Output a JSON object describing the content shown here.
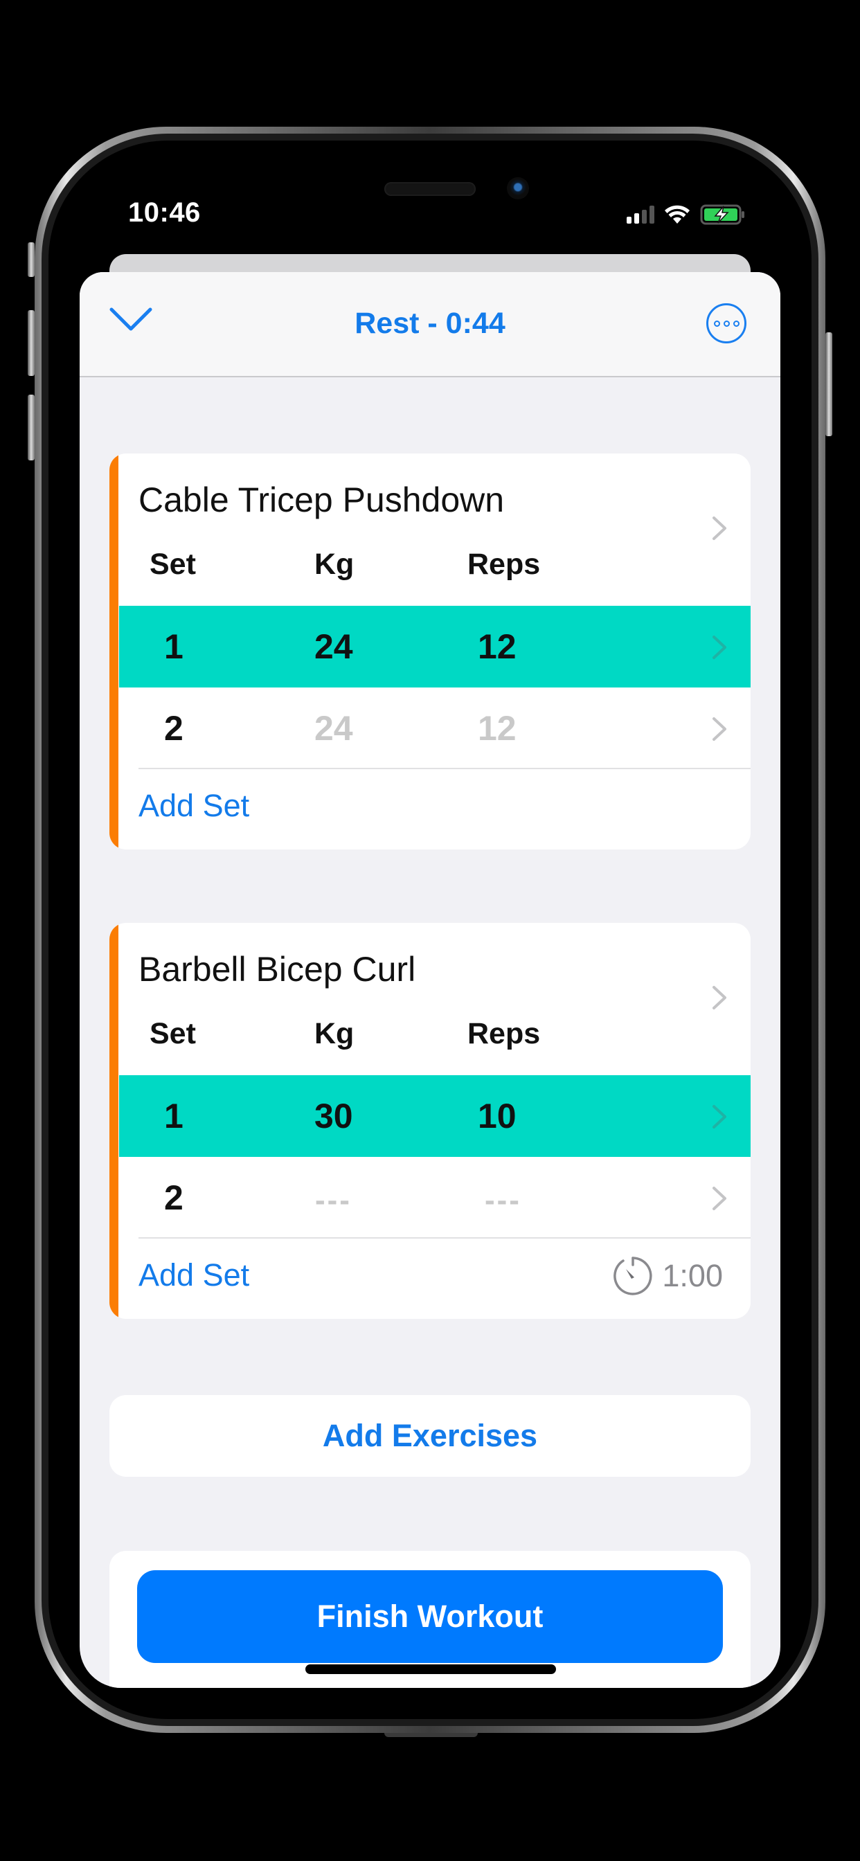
{
  "status_bar": {
    "time": "10:46",
    "icons": [
      "cellular-signal-icon",
      "wifi-icon",
      "battery-charging-icon"
    ],
    "battery_color": "#30d158"
  },
  "header": {
    "collapse_icon": "chevron-down-icon",
    "title": "Rest - 0:44",
    "more_icon": "ellipsis-circle-icon",
    "accent_color": "#137bea"
  },
  "columns": {
    "set": "Set",
    "kg": "Kg",
    "reps": "Reps"
  },
  "exercises": [
    {
      "name": "Cable Tricep Pushdown",
      "accent_color": "#fb7d04",
      "sets": [
        {
          "set": "1",
          "kg": "24",
          "reps": "12",
          "state": "active"
        },
        {
          "set": "2",
          "kg": "24",
          "reps": "12",
          "state": "placeholder"
        }
      ],
      "add_set_label": "Add Set"
    },
    {
      "name": "Barbell Bicep Curl",
      "accent_color": "#fb7d04",
      "sets": [
        {
          "set": "1",
          "kg": "30",
          "reps": "10",
          "state": "active"
        },
        {
          "set": "2",
          "kg": "---",
          "reps": "---",
          "state": "empty"
        }
      ],
      "add_set_label": "Add Set",
      "rest_timer": {
        "icon": "stopwatch-icon",
        "value": "1:00"
      }
    }
  ],
  "active_row_color": "#00d9c4",
  "add_exercises_label": "Add Exercises",
  "finish_workout_label": "Finish Workout",
  "finish_button_color": "#007afe"
}
